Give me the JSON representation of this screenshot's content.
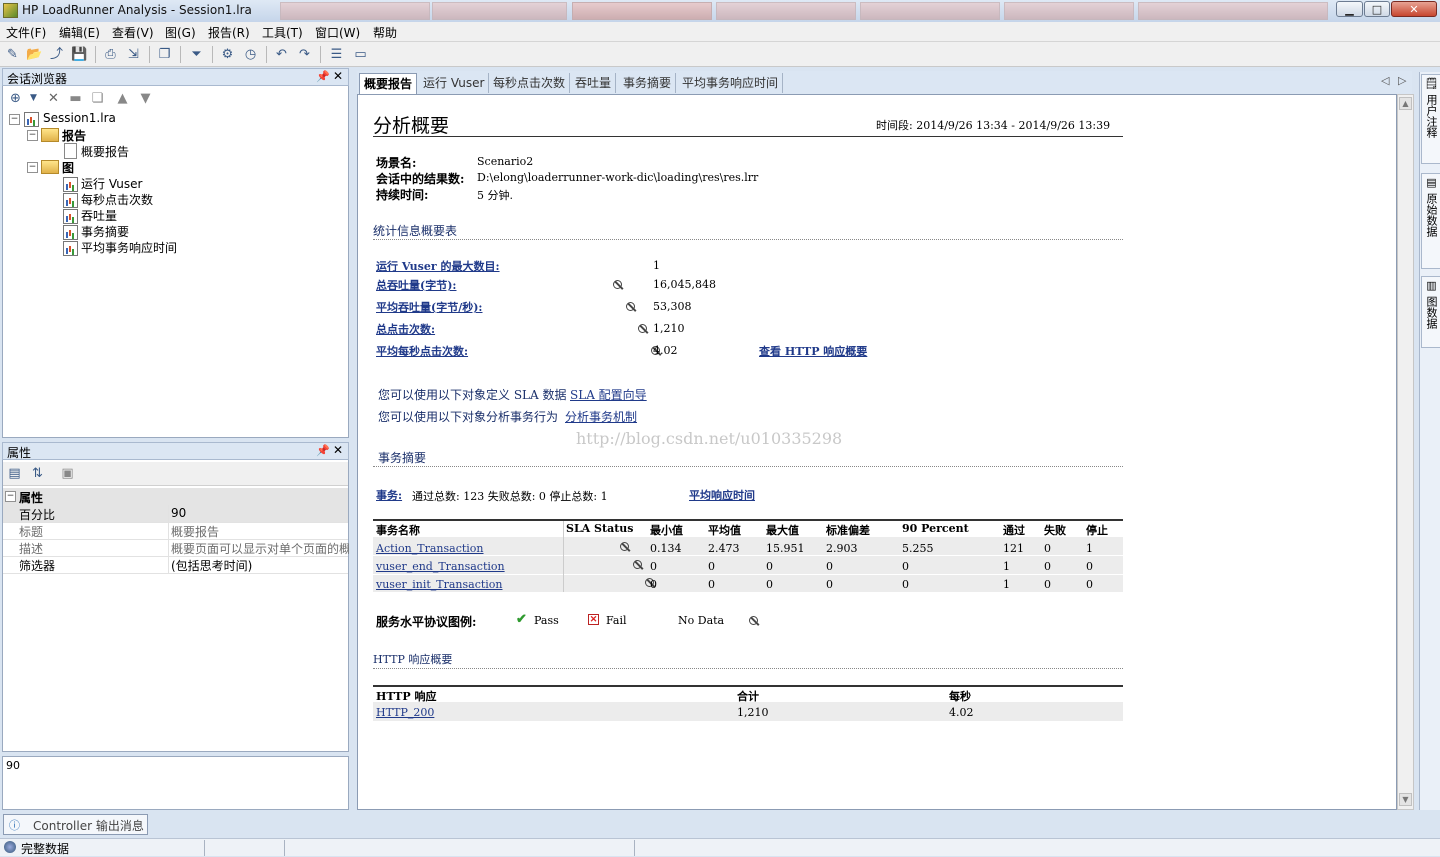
{
  "window": {
    "title": "HP LoadRunner Analysis - Session1.lra",
    "min_label": "▁",
    "max_label": "□",
    "close_label": "✕"
  },
  "menu": [
    "文件(F)",
    "编辑(E)",
    "查看(V)",
    "图(G)",
    "报告(R)",
    "工具(T)",
    "窗口(W)",
    "帮助"
  ],
  "session_panel": {
    "title": "会话浏览器",
    "root": "Session1.lra",
    "groups": [
      {
        "label": "报告",
        "items": [
          "概要报告"
        ]
      },
      {
        "label": "图",
        "items": [
          "运行 Vuser",
          "每秒点击次数",
          "吞吐量",
          "事务摘要",
          "平均事务响应时间"
        ]
      }
    ]
  },
  "props_panel": {
    "title": "属性",
    "section": "属性",
    "rows": [
      {
        "key": "百分比",
        "value": "90"
      },
      {
        "key": "标题",
        "value": "概要报告"
      },
      {
        "key": "描述",
        "value": "概要页面可以显示对单个页面的概"
      },
      {
        "key": "筛选器",
        "value": "(包括思考时间)"
      }
    ],
    "description_value": "90"
  },
  "tabs": [
    "概要报告",
    "运行 Vuser",
    "每秒点击次数",
    "吞吐量",
    "事务摘要",
    "平均事务响应时间"
  ],
  "report": {
    "title": "分析概要",
    "time_range": "时间段: 2014/9/26 13:34 - 2014/9/26 13:39",
    "scenario_label": "场景名:",
    "scenario_value": "Scenario2",
    "result_label": "会话中的结果数:",
    "result_value": "D:\\elong\\loaderrunner-work-dic\\loading\\res\\res.lrr",
    "duration_label": "持续时间:",
    "duration_value": "5 分钟.",
    "stats_title": "统计信息概要表",
    "stats": [
      {
        "label": "运行 Vuser 的最大数目:",
        "value": "1"
      },
      {
        "label": "总吞吐量(字节):",
        "value": "16,045,848"
      },
      {
        "label": "平均吞吐量(字节/秒):",
        "value": "53,308"
      },
      {
        "label": "总点击次数:",
        "value": "1,210"
      },
      {
        "label": "平均每秒点击次数:",
        "value": "4.02"
      }
    ],
    "http_link": "查看 HTTP 响应概要",
    "sla_text": "您可以使用以下对象定义 SLA 数据",
    "sla_link": "SLA 配置向导",
    "analyze_text": "您可以使用以下对象分析事务行为",
    "analyze_link": "分析事务机制",
    "watermark": "http://blog.csdn.net/u010335298",
    "tx_title": "事务摘要",
    "tx_label": "事务:",
    "tx_summary": "通过总数: 123 失败总数: 0 停止总数: 1",
    "avg_resp_link": "平均响应时间",
    "tx_headers": [
      "事务名称",
      "SLA Status",
      "最小值",
      "平均值",
      "最大值",
      "标准偏差",
      "90 Percent",
      "通过",
      "失败",
      "停止"
    ],
    "tx_rows": [
      [
        "Action_Transaction",
        "",
        "0.134",
        "2.473",
        "15.951",
        "2.903",
        "5.255",
        "121",
        "0",
        "1"
      ],
      [
        "vuser_end_Transaction",
        "",
        "0",
        "0",
        "0",
        "0",
        "0",
        "1",
        "0",
        "0"
      ],
      [
        "vuser_init_Transaction",
        "",
        "0",
        "0",
        "0",
        "0",
        "0",
        "1",
        "0",
        "0"
      ]
    ],
    "sla_legend_label": "服务水平协议图例:",
    "legend_pass": "Pass",
    "legend_fail": "Fail",
    "legend_nodata": "No Data",
    "http_title": "HTTP 响应概要",
    "http_headers": [
      "HTTP 响应",
      "合计",
      "每秒"
    ],
    "http_rows": [
      [
        "HTTP_200",
        "1,210",
        "4.02"
      ]
    ]
  },
  "right_tabs": [
    "用户注释",
    "原始数据",
    "图数据"
  ],
  "bottom_tab": "Controller 输出消息",
  "status": "完整数据"
}
